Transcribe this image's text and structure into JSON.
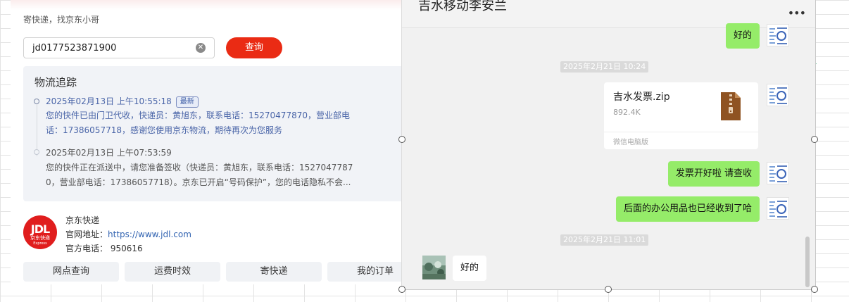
{
  "express": {
    "tagline": "寄快递，找京东小哥",
    "search_value": "jd0177523871900",
    "query_button": "查询",
    "tracking": {
      "title": "物流追踪",
      "latest_badge": "最新",
      "events": [
        {
          "time": "2025年02月13日 上午10:55:18",
          "lines": [
            "您的快件已由门卫代收，快递员：黄旭东，联系电话：15270477870，营业部电",
            "话：17386057718，感谢您使用京东物流，期待再次为您服务"
          ]
        },
        {
          "time": "2025年02月13日 上午07:53:59",
          "lines": [
            "您的快件正在派送中，请您准备签收（快递员：黄旭东，联系电话：1527047787",
            "0，营业部电话：17386057718）。京东已开启“号码保护”，您的电话隐私不会..."
          ]
        }
      ]
    },
    "company": {
      "logo_text": "JDL",
      "logo_sub": "京东快递",
      "logo_en": "Express",
      "name": "京东快递",
      "website_label": "官网地址：",
      "website_url": "https://www.jdl.com",
      "phone_label": "官方电话：",
      "phone": "950616"
    },
    "quick_tabs": [
      "网点查询",
      "运费时效",
      "寄快递",
      "我的订单"
    ]
  },
  "chat": {
    "title": "吉水移动李安兰",
    "more_icon": "•••",
    "messages": [
      {
        "type": "text",
        "from": "me",
        "text": "好的"
      },
      {
        "type": "time",
        "text": "2025年2月21日 10:24"
      },
      {
        "type": "file",
        "from": "me",
        "name": "吉水发票.zip",
        "size": "892.4K",
        "source": "微信电脑版",
        "icon": "zip-file-icon"
      },
      {
        "type": "text",
        "from": "me",
        "text": "发票开好啦 请查收"
      },
      {
        "type": "text",
        "from": "me",
        "text": "后面的办公用品也已经收到了哈"
      },
      {
        "type": "time",
        "text": "2025年2月21日 11:01"
      },
      {
        "type": "text",
        "from": "other",
        "text": "好的"
      }
    ]
  },
  "colors": {
    "brand_red": "#ea2b14",
    "jd_red": "#e01d1d",
    "my_bubble": "#95ec69",
    "tracking_blue": "#4a65a8"
  }
}
